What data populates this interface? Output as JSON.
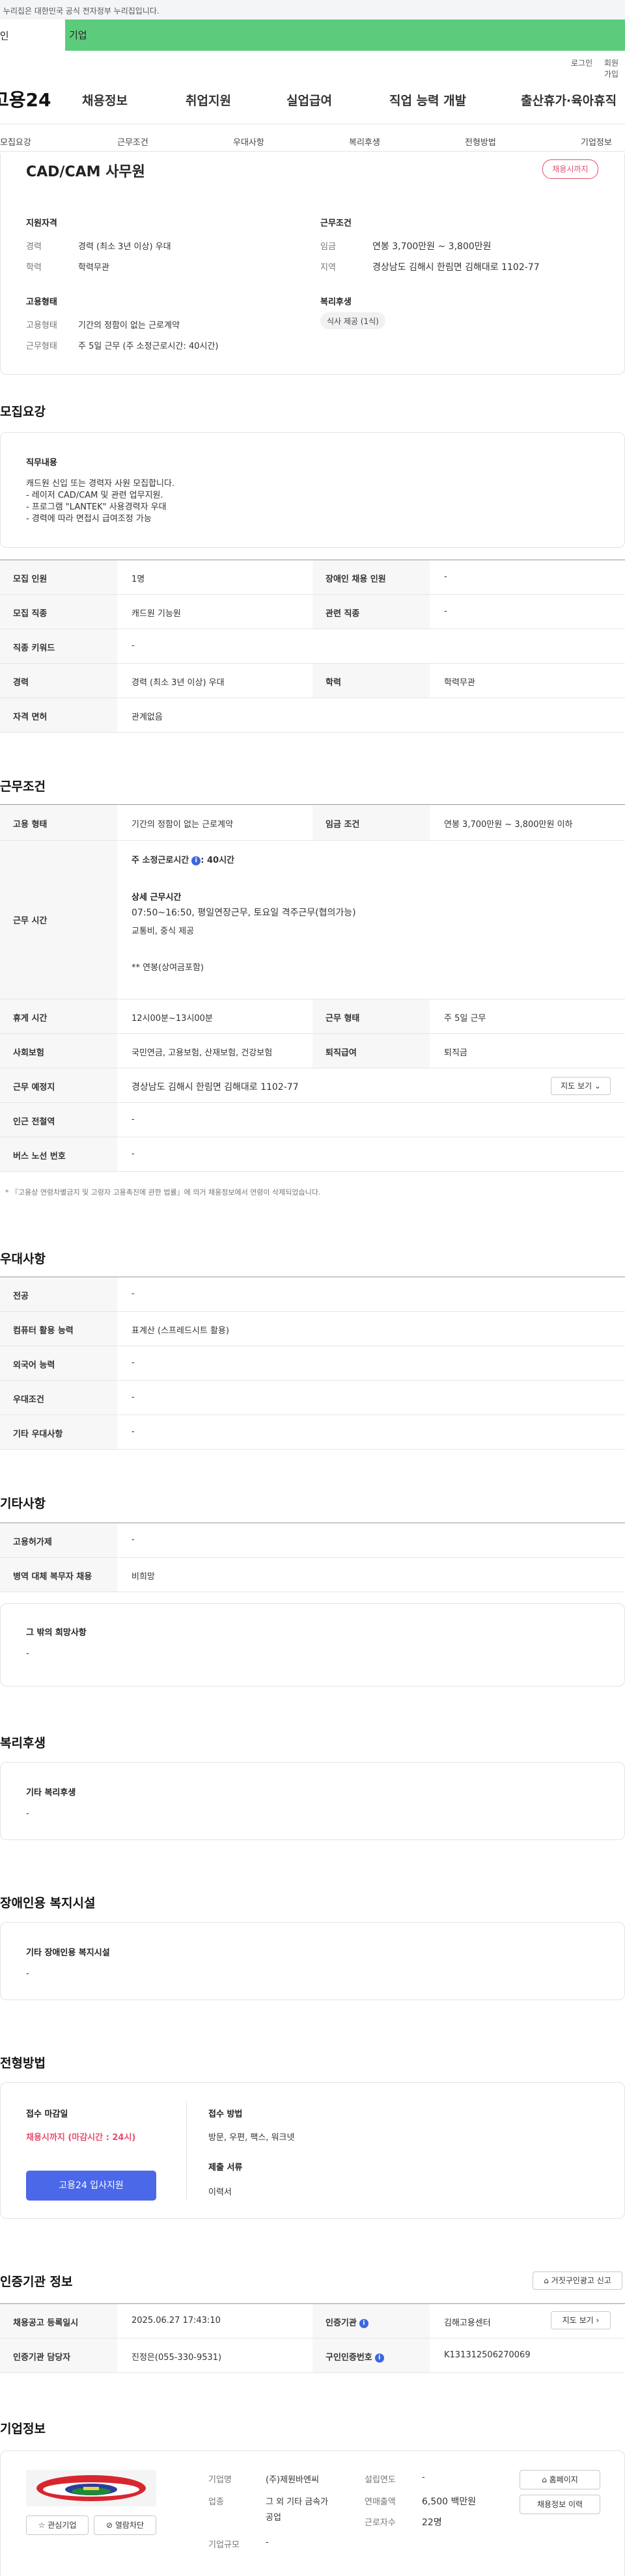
{
  "gov_banner": "이 누리집은 대한민국 공식 전자정부 누리집입니다.",
  "tabs": {
    "individual": "개인",
    "company": "기업"
  },
  "util": {
    "login": "로그인",
    "join": "회원가입"
  },
  "logo": "고용24",
  "gnb": [
    "채용정보",
    "취업지원",
    "실업급여",
    "직업 능력 개발",
    "출산휴가·육아휴직"
  ],
  "sub_nav": [
    "모집요강",
    "근무조건",
    "우대사항",
    "복리후생",
    "전형방법",
    "기업정보"
  ],
  "summary": {
    "title": "CAD/CAM 사무원",
    "badge": "채용시까지",
    "qual_heading": "지원자격",
    "career_label": "경력",
    "career_value": "경력 (최소 3년 이상) 우대",
    "edu_label": "학력",
    "edu_value": "학력무관",
    "cond_heading": "근무조건",
    "wage_label": "임금",
    "wage_value": "연봉 3,700만원 ~ 3,800만원",
    "region_label": "지역",
    "region_value": "경상남도 김해시 한림면 김해대로 1102-77",
    "emp_heading": "고용형태",
    "emptype_label": "고용형태",
    "emptype_value": "기간의 정함이 없는 근로계약",
    "worktype_label": "근무형태",
    "worktype_value": "주 5일 근무 (주 소정근로시간: 40시간)",
    "welfare_heading": "복리후생",
    "welfare_chip": "식사 제공 (1식)"
  },
  "recruit": {
    "title": "모집요강",
    "duty_heading": "직무내용",
    "duty_lines": [
      "캐드원 신입 또는 경력자 사원 모집합니다.",
      "- 레이저 CAD/CAM 및 관련 업무지원.",
      "- 프로그램 \"LANTEK\" 사용경력자 우대",
      "- 경력에 따라 면접시 급여조정 가능"
    ],
    "rows": [
      {
        "l1": "모집 인원",
        "v1": "1명",
        "l2": "장애인 채용 인원",
        "v2": "-"
      },
      {
        "l1": "모집 직종",
        "v1": "캐드원 기능원",
        "l2": "관련 직종",
        "v2": "-"
      },
      {
        "l1": "직종 키워드",
        "v1": "-"
      },
      {
        "l1": "경력",
        "v1": "경력 (최소 3년 이상) 우대",
        "l2": "학력",
        "v2": "학력무관"
      },
      {
        "l1": "자격 면허",
        "v1": "관계없음"
      }
    ]
  },
  "work": {
    "title": "근무조건",
    "emptype_label": "고용 형태",
    "emptype_value": "기간의 정함이 없는 근로계약",
    "wage_label": "임금 조건",
    "wage_value": "연봉 3,700만원 ~ 3,800만원 이하",
    "hours_label": "근무 시간",
    "hours_main": "주 소정근로시간",
    "hours_main_val": ": 40시간",
    "hours_detail_heading": "상세 근무시간",
    "hours_detail_1": "07:50~16:50,  평일연장근무,  토요일 격주근무(협의가능)",
    "hours_detail_2": "교통비, 중식 제공",
    "hours_note": "** 연봉(상여금포함)",
    "break_label": "휴게 시간",
    "break_value": "12시00분~13시00분",
    "worktype_label": "근무 형태",
    "worktype_value": "주 5일 근무",
    "insurance_label": "사회보험",
    "insurance_value": "국민연금, 고용보험, 산재보험, 건강보험",
    "severance_label": "퇴직급여",
    "severance_value": "퇴직금",
    "place_label": "근무 예정지",
    "place_value": "경상남도 김해시 한림면 김해대로 1102-77",
    "map_btn": "지도 보기",
    "subway_label": "인근 전철역",
    "subway_value": "-",
    "bus_label": "버스 노선 번호",
    "bus_value": "-",
    "footnote": "* 『고용상 연령차별금지 및 고령자 고용촉진에 관한 법률』에 의거 채용정보에서 연령이 삭제되었습니다."
  },
  "pref": {
    "title": "우대사항",
    "rows": [
      {
        "l": "전공",
        "v": "-"
      },
      {
        "l": "컴퓨터 활용 능력",
        "v": "표계산 (스프레드시트 활용)"
      },
      {
        "l": "외국어 능력",
        "v": "-"
      },
      {
        "l": "우대조건",
        "v": "-"
      },
      {
        "l": "기타 우대사항",
        "v": "-"
      }
    ]
  },
  "etc": {
    "title": "기타사항",
    "rows": [
      {
        "l": "고용허가제",
        "v": "-"
      },
      {
        "l": "병역 대체 복무자 채용",
        "v": "비희망"
      }
    ],
    "hope_heading": "그 밖의 희망사항",
    "hope_value": "-"
  },
  "welfare": {
    "title": "복리후생",
    "heading": "기타 복리후생",
    "value": "-"
  },
  "disabled": {
    "title": "장애인용 복지시설",
    "heading": "기타 장애인용 복지시설",
    "value": "-"
  },
  "selection": {
    "title": "전형방법",
    "deadline_label": "접수 마감일",
    "deadline_value": "채용시까지 (마감시간 : 24시)",
    "apply_btn": "고용24 입사지원",
    "method_label": "접수 방법",
    "method_value": "방문, 우편, 팩스, 워크넷",
    "docs_label": "제출 서류",
    "docs_value": "이력서"
  },
  "agency": {
    "title": "인증기관 정보",
    "report_btn": "거짓구인광고 신고",
    "reg_date_label": "채용공고 등록일시",
    "reg_date_value": "2025.06.27 17:43:10",
    "agency_label": "인증기관",
    "agency_value": "김해고용센터",
    "map_btn": "지도 보기",
    "manager_label": "인증기관 담당자",
    "manager_value": "진정은(055-330-9531)",
    "reg_no_label": "구인인증번호",
    "reg_no_value": "K131312506270069"
  },
  "company": {
    "title": "기업정보",
    "fav_btn": "관심기업",
    "block_btn": "열람차단",
    "name_label": "기업명",
    "name_value": "(주)제원바엔씨",
    "industry_label": "업종",
    "industry_value_1": "그 외 기타 금속가",
    "industry_value_2": "공업",
    "size_label": "기업규모",
    "size_value": "-",
    "founded_label": "설립연도",
    "founded_value": "-",
    "sales_label": "연매출액",
    "sales_value": "6,500 백만원",
    "employees_label": "근로자수",
    "employees_value": "22명",
    "homepage_btn": "홈페이지",
    "history_btn": "채용정보 이력"
  },
  "colors": {
    "company_tab": "#5ccc7c",
    "accent_red": "#e34f6f",
    "apply_blue": "#4a68e8"
  }
}
